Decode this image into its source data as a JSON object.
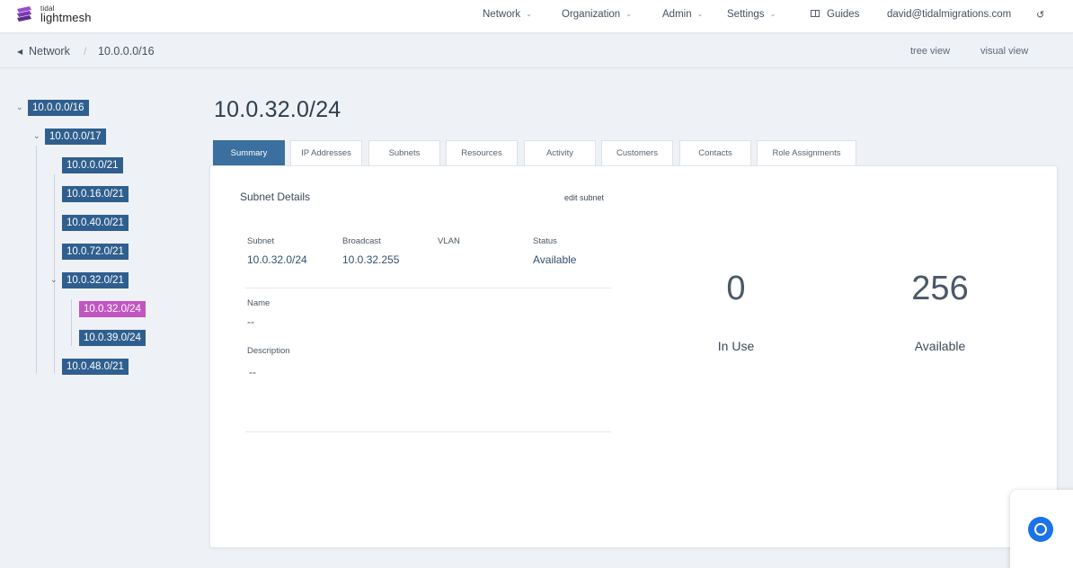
{
  "brand": {
    "small": "tidal",
    "name": "lightmesh",
    "colors": [
      "#9b4dca",
      "#5b2d8e"
    ]
  },
  "nav": {
    "items": [
      {
        "label": "Network",
        "has_menu": true
      },
      {
        "label": "Organization",
        "has_menu": true
      },
      {
        "label": "Admin",
        "has_menu": true
      },
      {
        "label": "Settings",
        "has_menu": true
      }
    ],
    "guides": "Guides",
    "user_email": "david@tidalmigrations.com",
    "logout_icon": "logout-icon"
  },
  "breadcrumb": {
    "back_icon": "caret-left-icon",
    "parent": "Network",
    "separator": "/",
    "current": "10.0.0.0/16"
  },
  "views": {
    "tree": "tree view",
    "visual": "visual view"
  },
  "tree": [
    {
      "label": "10.0.0.0/16",
      "expanded": true
    },
    {
      "label": "10.0.0.0/17",
      "expanded": true
    },
    {
      "label": "10.0.0.0/21"
    },
    {
      "label": "10.0.16.0/21"
    },
    {
      "label": "10.0.40.0/21"
    },
    {
      "label": "10.0.72.0/21"
    },
    {
      "label": "10.0.32.0/21",
      "expanded": true
    },
    {
      "label": "10.0.32.0/24",
      "selected": true
    },
    {
      "label": "10.0.39.0/24"
    },
    {
      "label": "10.0.48.0/21"
    }
  ],
  "title": "10.0.32.0/24",
  "tabs": [
    "Summary",
    "IP Addresses",
    "Subnets",
    "Resources",
    "Activity",
    "Customers",
    "Contacts",
    "Role Assignments"
  ],
  "active_tab": "Summary",
  "details": {
    "section_title": "Subnet Details",
    "edit_label": "edit subnet",
    "fields": [
      {
        "label": "Subnet",
        "value": "10.0.32.0/24"
      },
      {
        "label": "Broadcast",
        "value": "10.0.32.255"
      },
      {
        "label": "VLAN",
        "value": ""
      },
      {
        "label": "Status",
        "value": "Available"
      }
    ],
    "name_label": "Name",
    "name_value": "--",
    "description_label": "Description",
    "description_value": "--"
  },
  "stats": [
    {
      "value": "0",
      "label": "In Use"
    },
    {
      "value": "256",
      "label": "Available"
    }
  ],
  "colors": {
    "tree_node": "#2f5f8e",
    "tree_selected": "#c255c2",
    "tab_active": "#3b6fa0",
    "popup_icon": "#1a73e8"
  }
}
